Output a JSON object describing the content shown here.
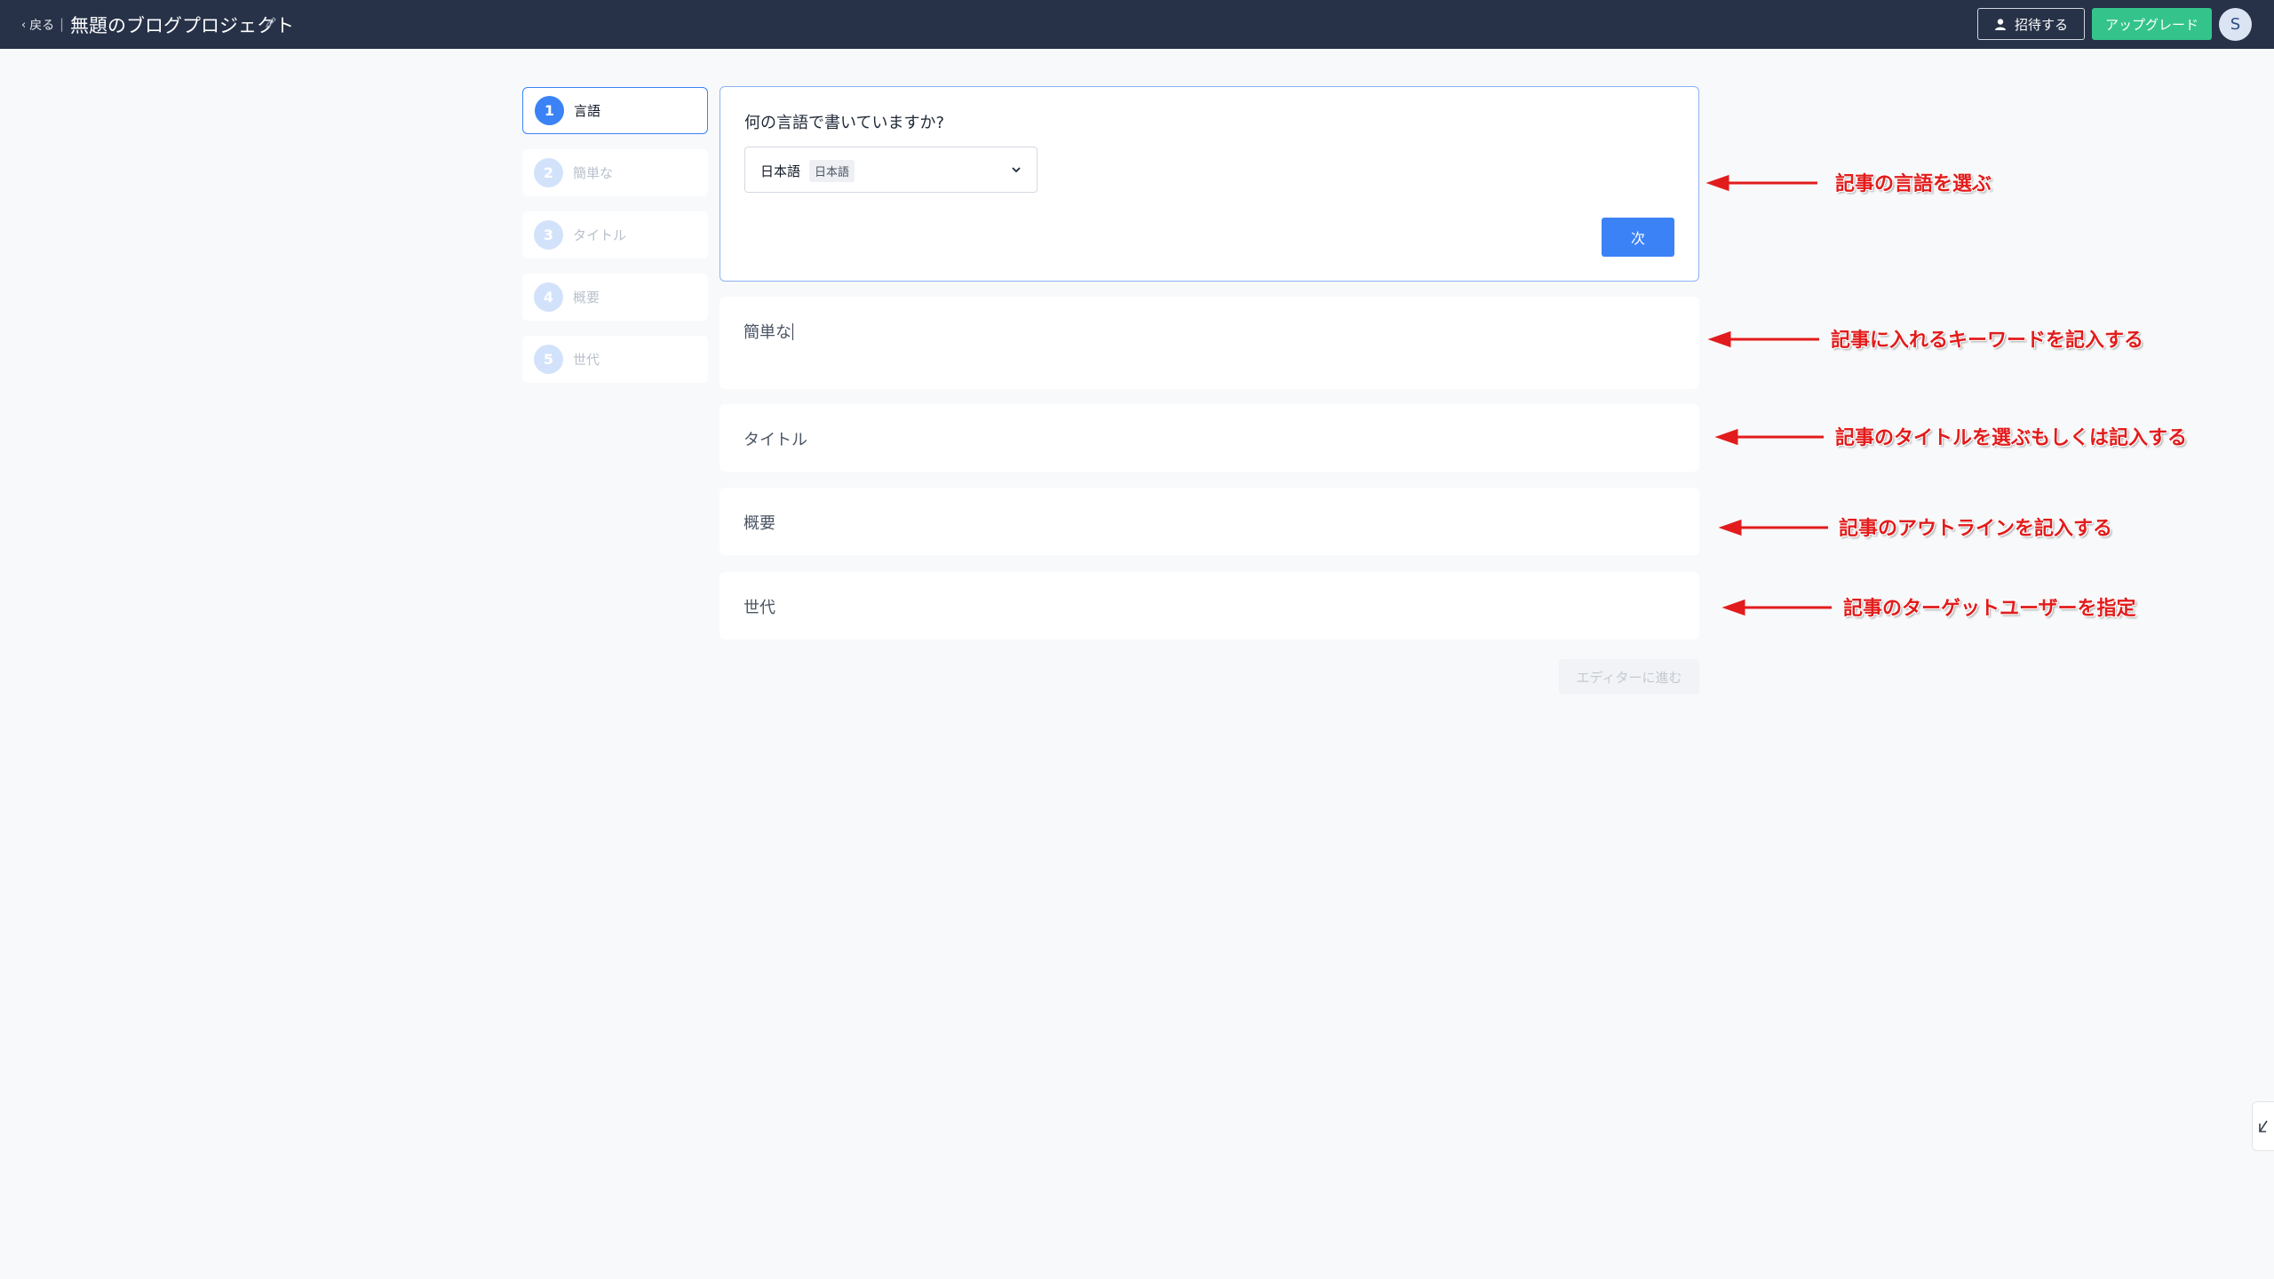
{
  "topbar": {
    "back_label": "戻る",
    "separator": "|",
    "project_title": "無題のブログプロジェクト",
    "invite_label": "招待する",
    "upgrade_label": "アップグレード",
    "avatar_initial": "S"
  },
  "steps": [
    {
      "num": "1",
      "label": "言語",
      "active": true
    },
    {
      "num": "2",
      "label": "簡単な",
      "active": false
    },
    {
      "num": "3",
      "label": "タイトル",
      "active": false
    },
    {
      "num": "4",
      "label": "概要",
      "active": false
    },
    {
      "num": "5",
      "label": "世代",
      "active": false
    }
  ],
  "language_card": {
    "question": "何の言語で書いていますか?",
    "selected_language": "日本語",
    "selected_language_native": "日本語",
    "next_label": "次"
  },
  "sections": {
    "brief_label": "簡単な",
    "title_label": "タイトル",
    "summary_label": "概要",
    "generation_label": "世代"
  },
  "editor_button_label": "エディターに進む",
  "annotations": [
    "記事の言語を選ぶ",
    "記事に入れるキーワードを記入する",
    "記事のタイトルを選ぶもしくは記入する",
    "記事のアウトラインを記入する",
    "記事のターゲットユーザーを指定"
  ],
  "colors": {
    "topbar_bg": "#273248",
    "accent_blue": "#3b82f6",
    "upgrade_green": "#34c48b",
    "annotation_red": "#e21c1c"
  }
}
